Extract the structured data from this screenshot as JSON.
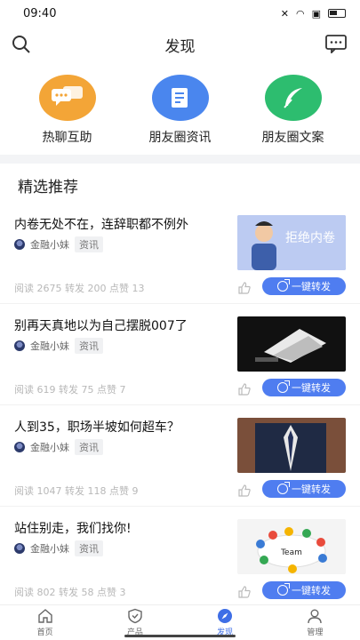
{
  "status": {
    "time": "09:40"
  },
  "header": {
    "title": "发现"
  },
  "quick": [
    {
      "label": "热聊互助",
      "color": "#f3a537"
    },
    {
      "label": "朋友圈资讯",
      "color": "#4a86ee"
    },
    {
      "label": "朋友圈文案",
      "color": "#2dbd6f"
    }
  ],
  "section": {
    "title": "精选推荐"
  },
  "articles": [
    {
      "title": "内卷无处不在，连辞职都不例外",
      "author": "金融小妹",
      "tag": "资讯",
      "stats": "阅读 2675  转发 200  点赞 13",
      "share": "一键转发",
      "thumb_text": "拒绝内卷"
    },
    {
      "title": "别再天真地以为自己摆脱007了",
      "author": "金融小妹",
      "tag": "资讯",
      "stats": "阅读 619  转发 75  点赞 7",
      "share": "一键转发"
    },
    {
      "title": "人到35，职场半坡如何超车？",
      "author": "金融小妹",
      "tag": "资讯",
      "stats": "阅读 1047  转发 118  点赞 9",
      "share": "一键转发"
    },
    {
      "title": "站住别走，我们找你!",
      "author": "金融小妹",
      "tag": "资讯",
      "stats": "阅读 802  转发 58  点赞 3",
      "share": "一键转发",
      "thumb_text": "Team"
    }
  ],
  "tabs": [
    {
      "label": "首页"
    },
    {
      "label": "产品"
    },
    {
      "label": "发现"
    },
    {
      "label": "管理"
    }
  ],
  "colors": {
    "accent": "#3e6ee6",
    "share_button": "#4f7df0"
  }
}
